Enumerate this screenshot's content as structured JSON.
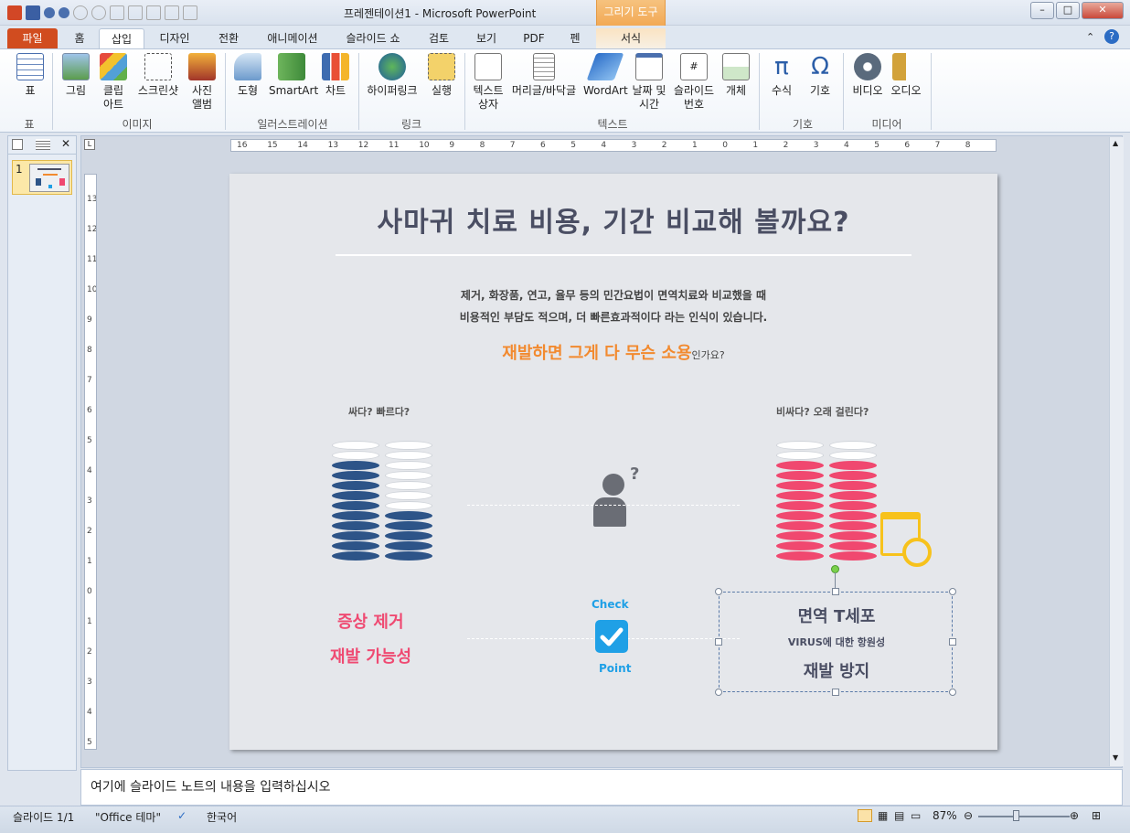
{
  "window": {
    "title": "프레젠테이션1 - Microsoft PowerPoint",
    "context_tab_group": "그리기 도구"
  },
  "tabs": [
    "파일",
    "홈",
    "삽입",
    "디자인",
    "전환",
    "애니메이션",
    "슬라이드 쇼",
    "검토",
    "보기",
    "PDF",
    "펜",
    "서식"
  ],
  "ribbon": {
    "table": {
      "label": "표",
      "group": "표"
    },
    "images": {
      "picture": "그림",
      "clipart": "클립\n아트",
      "screenshot": "스크린샷",
      "album": "사진\n앨범",
      "group": "이미지"
    },
    "illustrations": {
      "shapes": "도형",
      "smartart": "SmartArt",
      "chart": "차트",
      "group": "일러스트레이션"
    },
    "links": {
      "hyperlink": "하이퍼링크",
      "action": "실행",
      "group": "링크"
    },
    "text": {
      "textbox": "텍스트\n상자",
      "headerfooter": "머리글/바닥글",
      "wordart": "WordArt",
      "datetime": "날짜 및\n시간",
      "slidenum": "슬라이드\n번호",
      "object": "개체",
      "group": "텍스트"
    },
    "symbols": {
      "equation": "수식",
      "symbol": "기호",
      "group": "기호"
    },
    "media": {
      "video": "비디오",
      "audio": "오디오",
      "group": "미디어"
    }
  },
  "thumbnail": {
    "number": "1"
  },
  "slide": {
    "title": "사마귀 치료 비용, 기간 비교해 볼까요?",
    "sub1": "제거, 화장품, 연고, 율무 등의 민간요법이 면역치료와 비교했을 때",
    "sub2": "비용적인 부담도 적으며, 더 빠른효과적이다 라는 인식이 있습니다.",
    "tagline_main": "재발하면 그게 다 무슨 소용",
    "tagline_small": "인가요?",
    "left_caption": "싸다? 빠르다?",
    "right_caption": "비싸다? 오래 걸린다?",
    "left_point1": "증상 제거",
    "left_point2": "재발 가능성",
    "check": "Check",
    "point": "Point",
    "box_line1": "면역 T세포",
    "box_line2": "VIRUS에 대한 항원성",
    "box_line3": "재발 방지",
    "colors": {
      "navy": "#2d5488",
      "pink": "#f0486f",
      "orange": "#f28a2f",
      "blue": "#1fa0e6",
      "yellow": "#f7c21c"
    }
  },
  "ruler": {
    "h_ticks": [
      "16",
      "15",
      "14",
      "13",
      "12",
      "11",
      "10",
      "9",
      "8",
      "7",
      "6",
      "5",
      "4",
      "3",
      "2",
      "1",
      "0",
      "1",
      "2",
      "3",
      "4",
      "5",
      "6",
      "7",
      "8"
    ],
    "v_ticks": [
      "13",
      "12",
      "11",
      "10",
      "9",
      "8",
      "7",
      "6",
      "5",
      "4",
      "3",
      "2",
      "1",
      "0",
      "1",
      "2",
      "3",
      "4",
      "5"
    ]
  },
  "notes": {
    "placeholder": "여기에 슬라이드 노트의 내용을 입력하십시오"
  },
  "status": {
    "slide": "슬라이드 1/1",
    "theme": "\"Office 테마\"",
    "language": "한국어",
    "zoom": "87%"
  }
}
